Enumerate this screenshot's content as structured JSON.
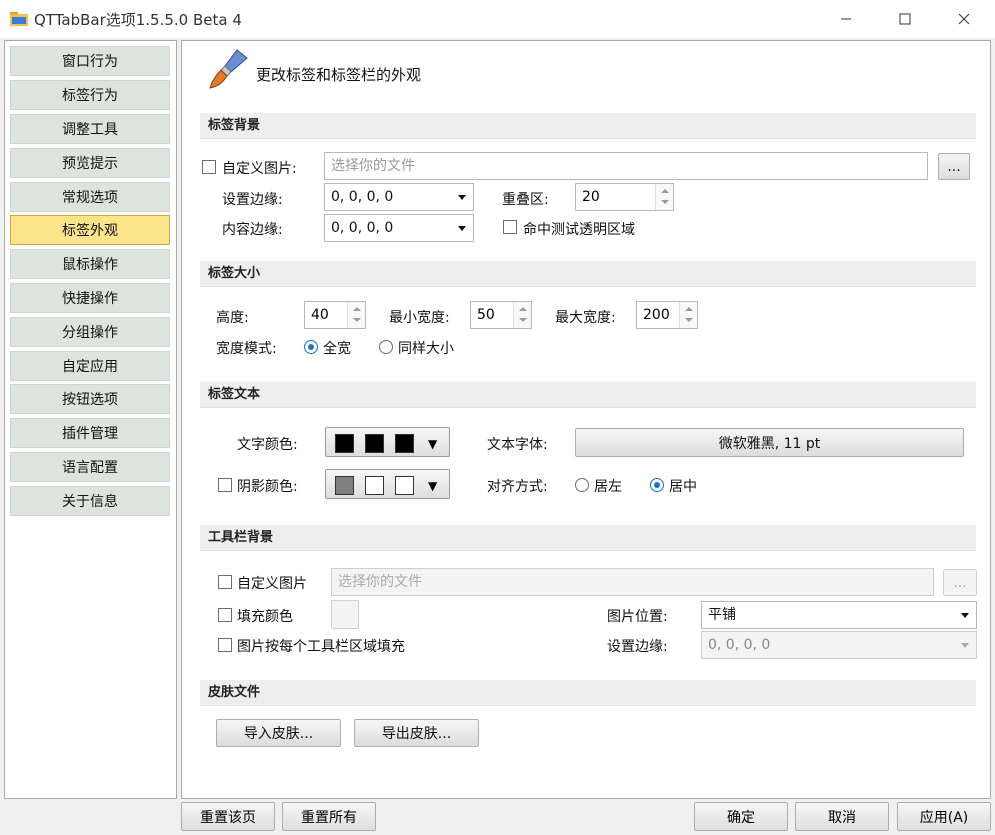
{
  "window": {
    "title": "QTTabBar选项1.5.5.0 Beta 4",
    "minimize_icon": "minimize-icon",
    "maximize_icon": "maximize-icon",
    "close_icon": "close-icon"
  },
  "sidebar": {
    "items": [
      {
        "label": "窗口行为",
        "active": false
      },
      {
        "label": "标签行为",
        "active": false
      },
      {
        "label": "调整工具",
        "active": false
      },
      {
        "label": "预览提示",
        "active": false
      },
      {
        "label": "常规选项",
        "active": false
      },
      {
        "label": "标签外观",
        "active": true
      },
      {
        "label": "鼠标操作",
        "active": false
      },
      {
        "label": "快捷操作",
        "active": false
      },
      {
        "label": "分组操作",
        "active": false
      },
      {
        "label": "自定应用",
        "active": false
      },
      {
        "label": "按钮选项",
        "active": false
      },
      {
        "label": "插件管理",
        "active": false
      },
      {
        "label": "语言配置",
        "active": false
      },
      {
        "label": "关于信息",
        "active": false
      }
    ],
    "active_color": "#fde48a"
  },
  "page": {
    "heading": "更改标签和标签栏的外观",
    "heading_icon": "paintbrush-icon"
  },
  "tab_background": {
    "header": "标签背景",
    "custom_image_label": "自定义图片:",
    "custom_image_checked": false,
    "file_placeholder": "选择你的文件",
    "browse_label": "...",
    "margin_label": "设置边缘:",
    "margin_value": "0, 0, 0, 0",
    "overlap_label": "重叠区:",
    "overlap_value": "20",
    "content_margin_label": "内容边缘:",
    "content_margin_value": "0, 0, 0, 0",
    "hit_test_label": "命中测试透明区域",
    "hit_test_checked": false
  },
  "tab_size": {
    "header": "标签大小",
    "height_label": "高度:",
    "height_value": "40",
    "min_width_label": "最小宽度:",
    "min_width_value": "50",
    "max_width_label": "最大宽度:",
    "max_width_value": "200",
    "width_mode_label": "宽度模式:",
    "mode_full_label": "全宽",
    "mode_same_label": "同样大小",
    "selected_mode": "全宽"
  },
  "tab_text": {
    "header": "标签文本",
    "text_color_label": "文字颜色:",
    "text_colors": [
      "#000000",
      "#000000",
      "#000000"
    ],
    "font_label": "文本字体:",
    "font_value": "微软雅黑, 11 pt",
    "shadow_color_label": "阴影颜色:",
    "shadow_checked": false,
    "shadow_colors": [
      "#808080",
      "#ffffff",
      "#ffffff"
    ],
    "align_label": "对齐方式:",
    "align_left_label": "居左",
    "align_center_label": "居中",
    "selected_align": "居中"
  },
  "toolbar_background": {
    "header": "工具栏背景",
    "custom_image_label": "自定义图片",
    "custom_image_checked": false,
    "file_placeholder": "选择你的文件",
    "browse_label": "...",
    "fill_color_label": "填充颜色",
    "fill_color_checked": false,
    "image_position_label": "图片位置:",
    "image_position_value": "平铺",
    "per_area_fill_label": "图片按每个工具栏区域填充",
    "per_area_fill_checked": false,
    "margin_label": "设置边缘:",
    "margin_value": "0, 0, 0, 0"
  },
  "skin_file": {
    "header": "皮肤文件",
    "import_label": "导入皮肤...",
    "export_label": "导出皮肤..."
  },
  "footer": {
    "reset_page_label": "重置该页",
    "reset_all_label": "重置所有",
    "ok_label": "确定",
    "cancel_label": "取消",
    "apply_label": "应用(A)"
  }
}
